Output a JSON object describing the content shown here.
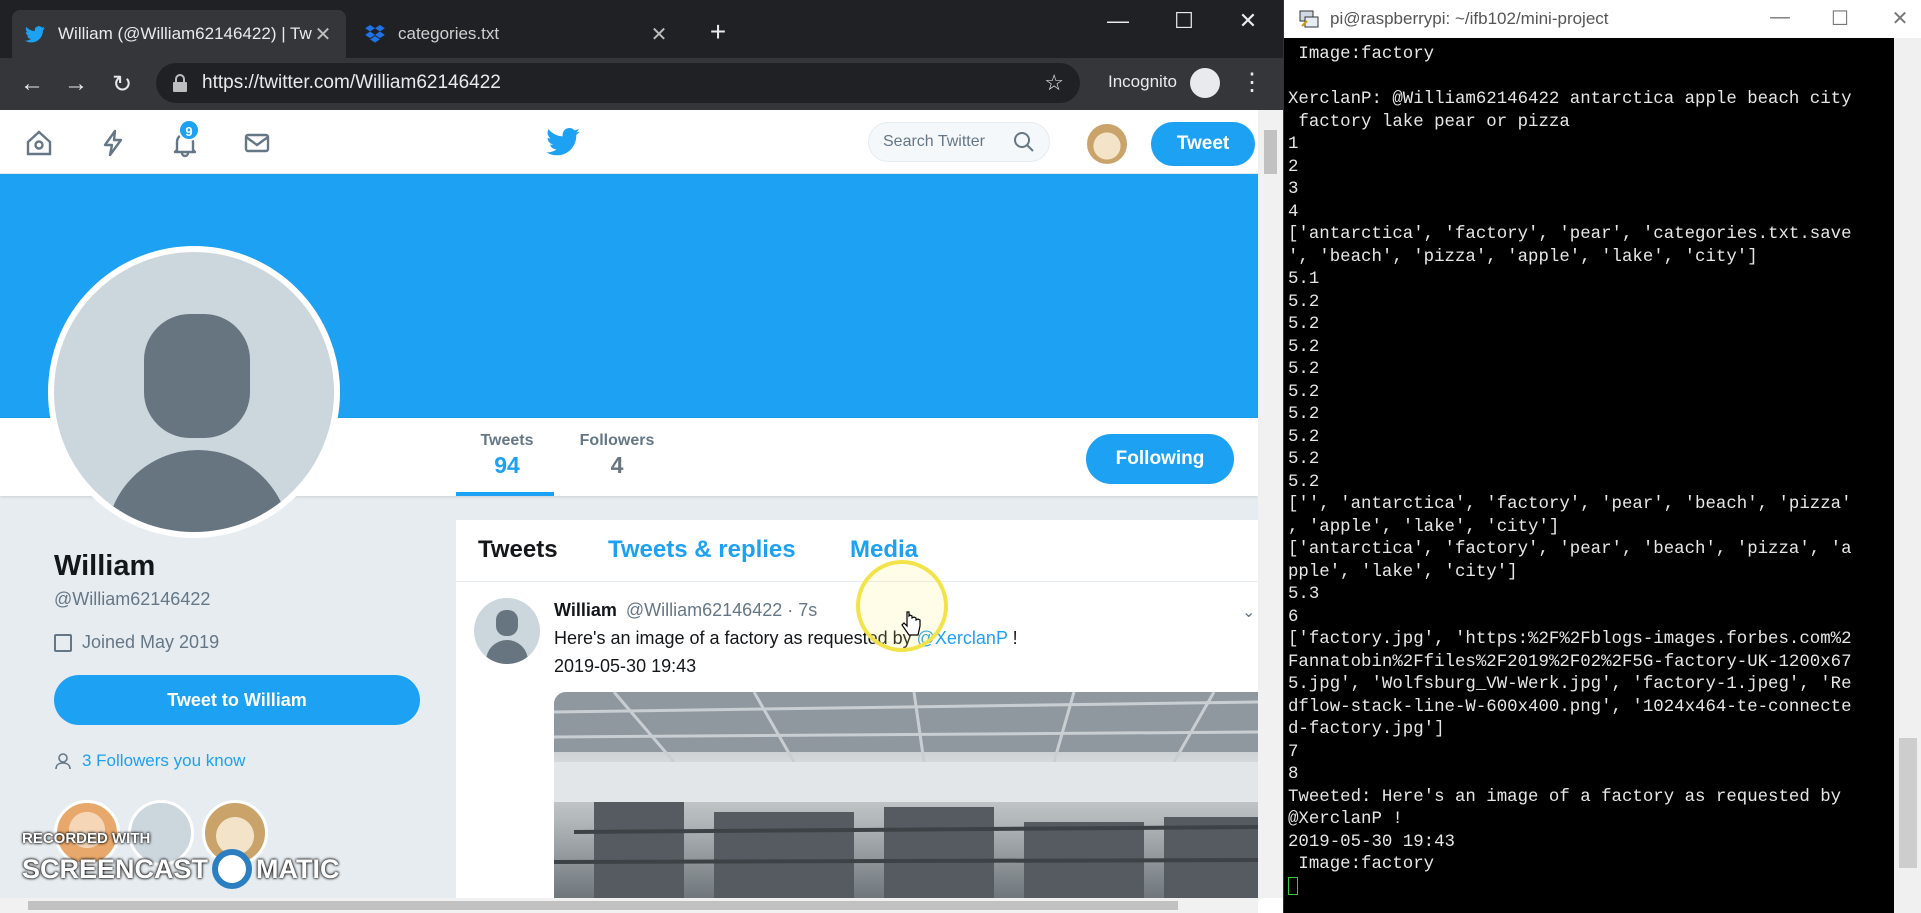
{
  "browser": {
    "tabs": [
      {
        "title": "William (@William62146422) | Tw"
      },
      {
        "title": "categories.txt"
      }
    ],
    "url": "https://twitter.com/William62146422",
    "incognito_label": "Incognito"
  },
  "twitter": {
    "notifications_count": "9",
    "search_placeholder": "Search Twitter",
    "tweet_button": "Tweet",
    "stats": {
      "tweets_label": "Tweets",
      "tweets_value": "94",
      "followers_label": "Followers",
      "followers_value": "4"
    },
    "following_button": "Following",
    "profile": {
      "name": "William",
      "handle": "@William62146422",
      "joined": "Joined May 2019",
      "tweet_to_button": "Tweet to William",
      "followers_you_know": "3 Followers you know"
    },
    "timeline_tabs": [
      "Tweets",
      "Tweets & replies",
      "Media"
    ],
    "tweet": {
      "author": "William",
      "handle_time": "@William62146422 · 7s",
      "text": "Here's an image of a factory as requested by ",
      "mention": "@XerclanP",
      "text_end": " !",
      "date": "2019-05-30 19:43"
    }
  },
  "watermark": {
    "line1": "RECORDED WITH",
    "line2a": "SCREENCAST",
    "line2b": "MATIC"
  },
  "terminal": {
    "title": "pi@raspberrypi: ~/ifb102/mini-project",
    "lines": [
      " Image:factory",
      "",
      "XerclanP: @William62146422 antarctica apple beach city",
      " factory lake pear or pizza",
      "1",
      "2",
      "3",
      "4",
      "['antarctica', 'factory', 'pear', 'categories.txt.save",
      "', 'beach', 'pizza', 'apple', 'lake', 'city']",
      "5.1",
      "5.2",
      "5.2",
      "5.2",
      "5.2",
      "5.2",
      "5.2",
      "5.2",
      "5.2",
      "5.2",
      "['', 'antarctica', 'factory', 'pear', 'beach', 'pizza'",
      ", 'apple', 'lake', 'city']",
      "['antarctica', 'factory', 'pear', 'beach', 'pizza', 'a",
      "pple', 'lake', 'city']",
      "5.3",
      "6",
      "['factory.jpg', 'https:%2F%2Fblogs-images.forbes.com%2",
      "Fannatobin%2Ffiles%2F2019%2F02%2F5G-factory-UK-1200x67",
      "5.jpg', 'Wolfsburg_VW-Werk.jpg', 'factory-1.jpeg', 'Re",
      "dflow-stack-line-W-600x400.png', '1024x464-te-connecte",
      "d-factory.jpg']",
      "7",
      "8",
      "Tweeted: Here's an image of a factory as requested by",
      "@XerclanP !",
      "2019-05-30 19:43",
      " Image:factory"
    ]
  }
}
